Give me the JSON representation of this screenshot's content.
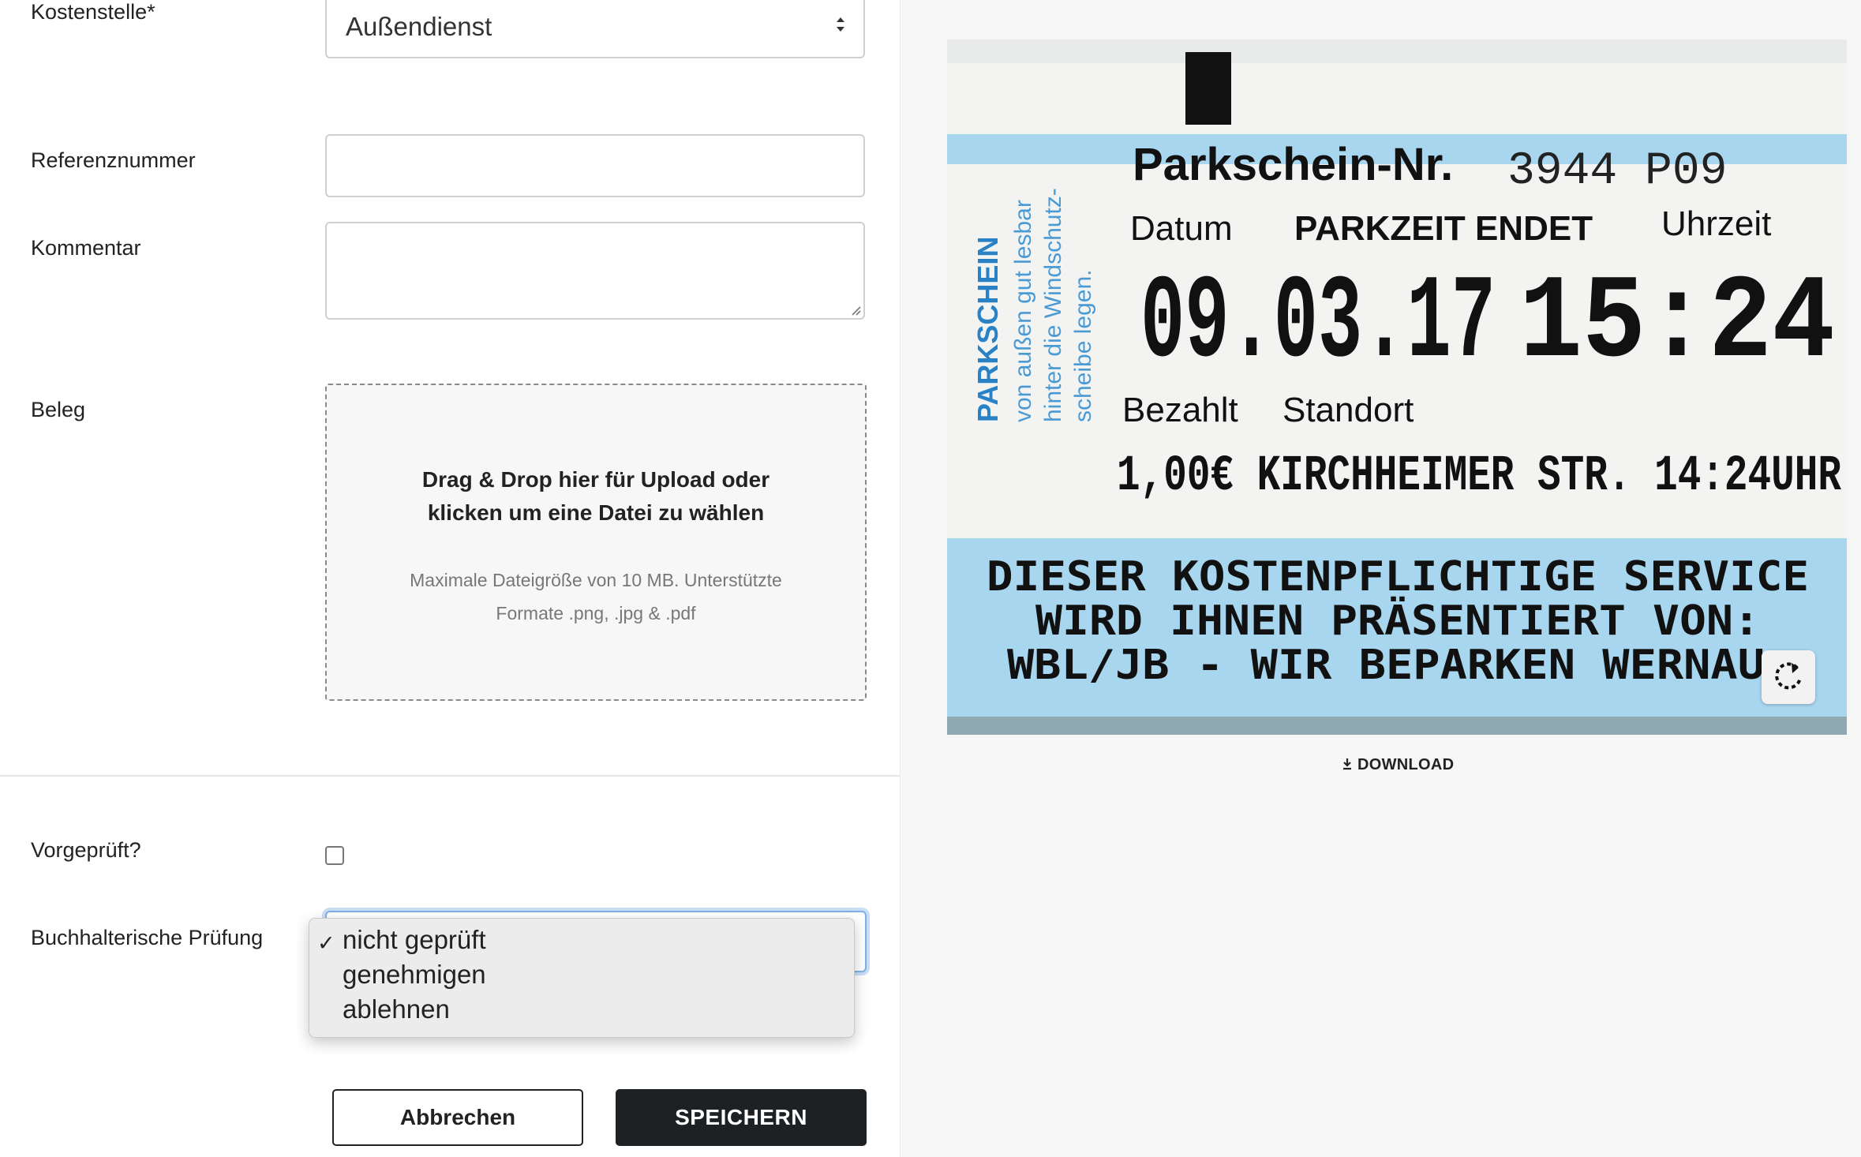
{
  "form": {
    "cost_center": {
      "label": "Kostenstelle*",
      "value": "Außendienst"
    },
    "reference": {
      "label": "Referenznummer",
      "value": ""
    },
    "comment": {
      "label": "Kommentar",
      "value": ""
    },
    "receipt": {
      "label": "Beleg",
      "drop_title_line1": "Drag & Drop hier für Upload oder",
      "drop_title_line2": "klicken um eine Datei zu wählen",
      "drop_hint_line1": "Maximale Dateigröße von 10 MB. Unterstützte",
      "drop_hint_line2": "Formate .png, .jpg & .pdf"
    },
    "prechecked": {
      "label": "Vorgeprüft?",
      "checked": false
    },
    "accounting_check": {
      "label": "Buchhalterische Prüfung",
      "selected": "nicht geprüft",
      "options": [
        "nicht geprüft",
        "genehmigen",
        "ablehnen"
      ]
    }
  },
  "buttons": {
    "cancel": "Abbrechen",
    "save": "SPEICHERN"
  },
  "preview": {
    "download_label": "DOWNLOAD",
    "ticket": {
      "title": "Parkschein-Nr.",
      "number": "3944 P09",
      "datum_label": "Datum",
      "end_label": "PARKZEIT ENDET",
      "time_label": "Uhrzeit",
      "date_value": "09.03.17",
      "time_value": "15:24",
      "side_title": "PARKSCHEIN",
      "side_line1": "von außen gut lesbar",
      "side_line2": "hinter die Windschutz-",
      "side_line3": "scheibe legen.",
      "paid_label": "Bezahlt",
      "location_label": "Standort",
      "paid_line": "1,00€ KIRCHHEIMER STR. 14:24UHR",
      "footer_line1": "DIESER KOSTENPFLICHTIGE SERVICE",
      "footer_line2": "WIRD IHNEN PRÄSENTIERT VON:",
      "footer_line3": "WBL/JB - WIR BEPARKEN WERNAU"
    }
  },
  "icons": {
    "select_arrows": "updown-chevron-icon",
    "rotate": "rotate-icon",
    "download": "download-icon",
    "checkmark": "checkmark-icon"
  },
  "colors": {
    "primary_button": "#1e2124",
    "focus_ring": "#7fb0e6",
    "ticket_band": "#a9d6ef",
    "ticket_side_text": "#2a82c6"
  }
}
